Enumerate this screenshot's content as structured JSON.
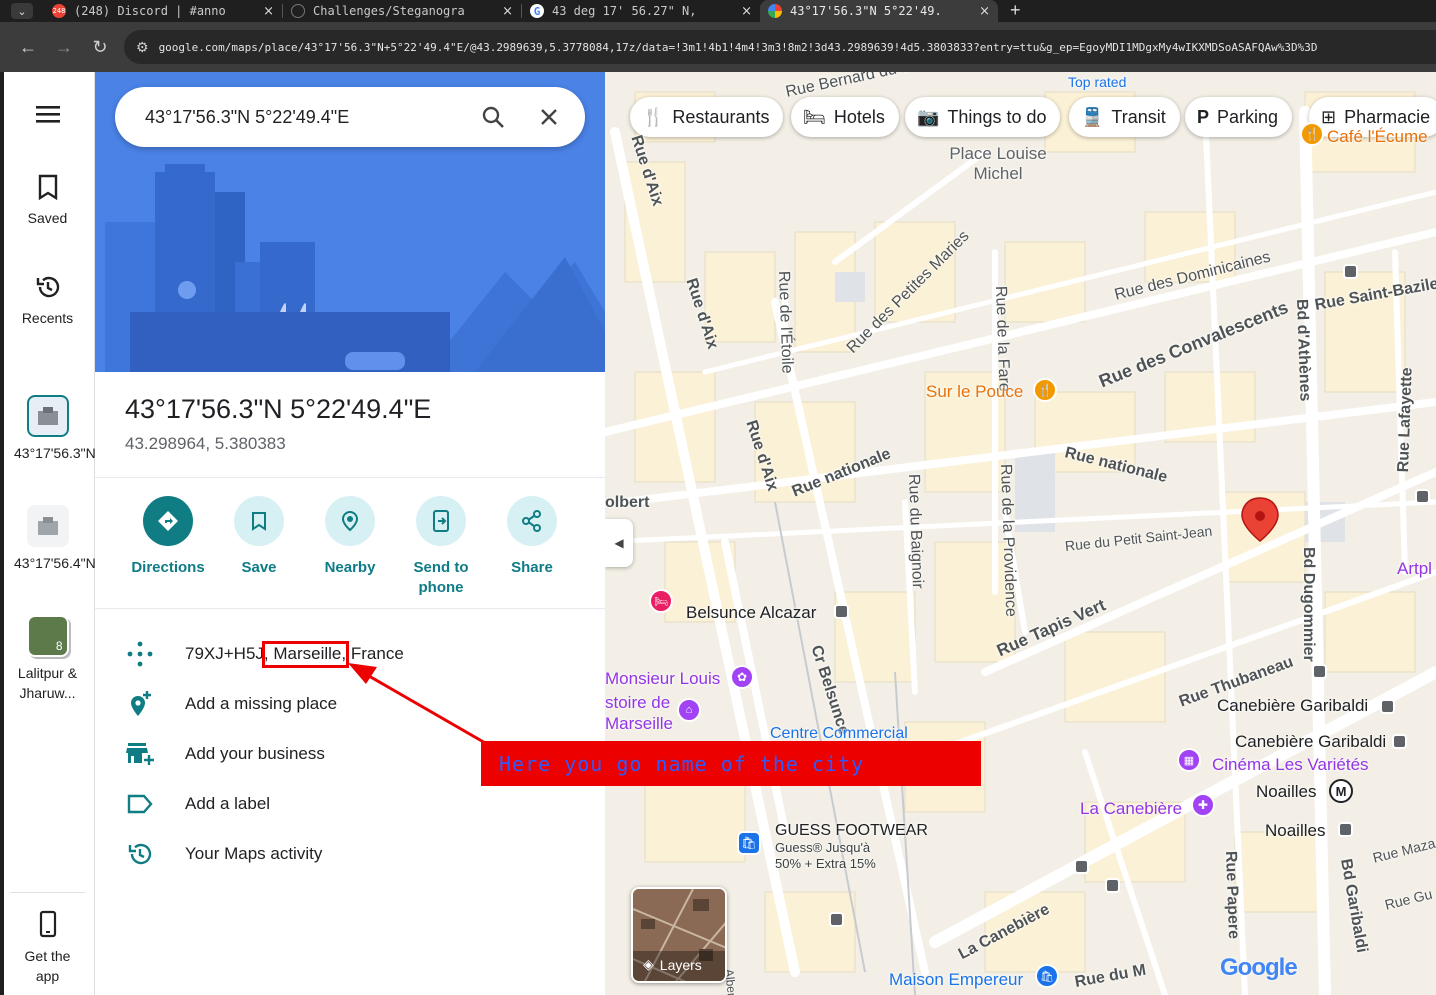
{
  "browser": {
    "tabs": [
      {
        "title": "(248) Discord | #anno",
        "badge": "248",
        "active": false
      },
      {
        "title": "Challenges/Steganogra",
        "active": false
      },
      {
        "title": "43 deg 17' 56.27\" N,",
        "active": false
      },
      {
        "title": "43°17'56.3\"N 5°22'49.",
        "active": true
      }
    ],
    "url": "google.com/maps/place/43°17'56.3\"N+5°22'49.4\"E/@43.2989639,5.3778084,17z/data=!3m1!4b1!4m4!3m3!8m2!3d43.2989639!4d5.3803833?entry=ttu&g_ep=EgoyMDI1MDgxMy4wIKXMDSoASAFQAw%3D%3D"
  },
  "rail": {
    "saved": "Saved",
    "recents": "Recents",
    "recent1": "43°17'56.3\"N...",
    "recent2": "43°17'56.4\"N...",
    "recent3": "Lalitpur & Jharuw...",
    "recent3_count": "8",
    "get_app": "Get the app"
  },
  "panel": {
    "search_value": "43°17'56.3\"N 5°22'49.4\"E",
    "title": "43°17'56.3\"N 5°22'49.4\"E",
    "decimal": "43.298964, 5.380383",
    "actions": {
      "directions": "Directions",
      "save": "Save",
      "nearby": "Nearby",
      "send": "Send to phone",
      "share": "Share"
    },
    "rows": {
      "plus_code_prefix": "79XJ+H5J",
      "city": "Marseille",
      "country": "France",
      "add_place": "Add a missing place",
      "add_business": "Add your business",
      "add_label": "Add a label",
      "activity": "Your Maps activity"
    }
  },
  "map": {
    "chips": {
      "restaurants": "Restaurants",
      "hotels": "Hotels",
      "things": "Things to do",
      "transit": "Transit",
      "parking": "Parking",
      "pharmacies": "Pharmacie"
    },
    "streets": {
      "rue_daix": "Rue d'Aix",
      "rue_etoile": "Rue de l'Étoile",
      "petites_maries": "Rue des Petites Maries",
      "rue_fare": "Rue de la Fare",
      "dominicaines": "Rue des Dominicaines",
      "convalescents": "Rue des Convalescents",
      "bd_athenes": "Bd d'Athènes",
      "saint_bazile": "Rue Saint-Bazile",
      "lafayette": "Rue Lafayette",
      "nationale": "Rue nationale",
      "baignoir": "Rue du Baignoir",
      "providence": "Rue de la Providence",
      "petit_saint_jean": "Rue du Petit Saint-Jean",
      "dugommier": "Bd Dugommier",
      "tapis_vert": "Rue Tapis Vert",
      "thubaneau": "Rue Thubaneau",
      "belsunce": "Cr Belsunce",
      "canebiere": "La Canebière",
      "papere": "Rue Papere",
      "garibaldi": "Bd Garibaldi",
      "bernard_du_bois": "Rue Bernard du Bois",
      "colbert": "olbert",
      "rue_du_m": "Rue du M",
      "rue_maza": "Rue Maza",
      "rue_gu": "Rue Gu",
      "albert": "Albert"
    },
    "pois": {
      "top_rated": "Top rated",
      "place_louise": "Place Louise Michel",
      "sur_le_pouce": "Sur le Pouce",
      "belsunce_alcazar": "Belsunce Alcazar",
      "monsieur_louis": "Monsieur Louis",
      "histoire": "stoire de Marseille",
      "centre": "Centre Commercial",
      "canebiere_garibaldi_1": "Canebière Garibaldi",
      "canebiere_garibaldi_2": "Canebière Garibaldi",
      "cinema": "Cinéma Les Variétés",
      "la_canebiere": "La Canebière",
      "noailles_1": "Noailles",
      "noailles_2": "Noailles",
      "guess": "GUESS FOOTWEAR",
      "guess_sub1": "Guess® Jusqu'à",
      "guess_sub2": "50% + Extra 15%",
      "maison": "Maison Empereur",
      "artpl": "Artpl",
      "cafe": "Café l'Écume"
    },
    "layers_label": "Layers",
    "google": "Google"
  },
  "annotation": {
    "text": "Here you go name of the city"
  },
  "colors": {
    "accent": "#0f7d83",
    "annotation_red": "#ed0000",
    "annotation_text": "#2e5bff",
    "pin_red": "#ea4335"
  }
}
